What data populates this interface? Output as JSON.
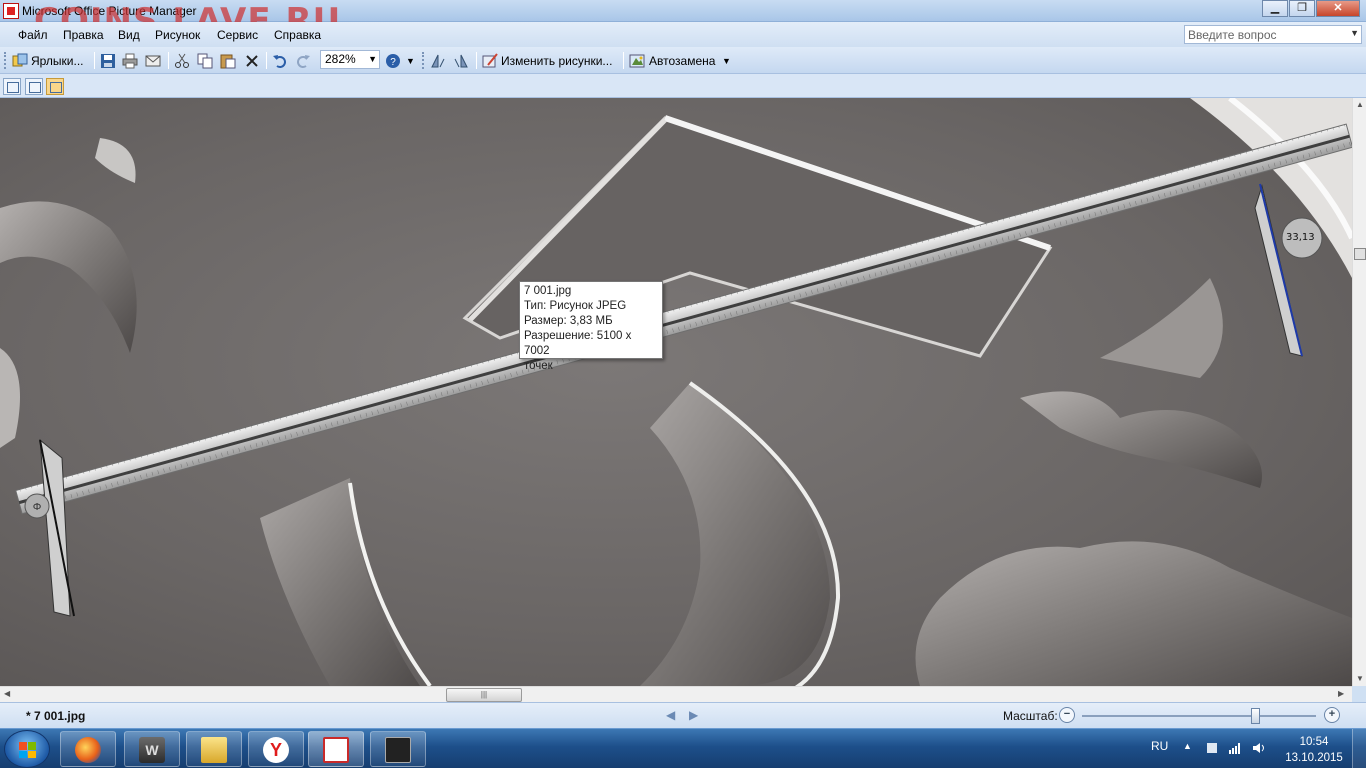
{
  "window": {
    "title": "Microsoft Office Picture Manager",
    "watermark": "COINS.LAVE.RU",
    "buttons": {
      "minimize": "▁",
      "maximize": "❐",
      "close": "✕"
    }
  },
  "menu": {
    "items": [
      {
        "label": "Файл"
      },
      {
        "label": "Правка"
      },
      {
        "label": "Вид"
      },
      {
        "label": "Рисунок"
      },
      {
        "label": "Сервис"
      },
      {
        "label": "Справка"
      }
    ],
    "help_placeholder": "Введите вопрос"
  },
  "toolbar": {
    "shortcuts_label": "Ярлыки...",
    "zoom_value": "282%",
    "edit_pictures_label": "Изменить рисунки...",
    "autocorrect_label": "Автозамена",
    "icons": [
      "shortcuts-icon",
      "save-icon",
      "print-icon",
      "email-icon",
      "cut-icon",
      "copy-icon",
      "paste-icon",
      "delete-icon",
      "undo-icon",
      "redo-icon",
      "help-icon",
      "rotate-left-icon",
      "rotate-right-icon",
      "edit-pictures-icon",
      "autocorrect-icon"
    ]
  },
  "views": {
    "buttons": [
      "thumbnail-view",
      "filmstrip-view",
      "single-picture-view"
    ],
    "active": "single-picture-view"
  },
  "caliper": {
    "reading": "33,13"
  },
  "tooltip": {
    "filename": "7 001.jpg",
    "type": "Тип: Рисунок JPEG",
    "size": "Размер: 3,83 МБ",
    "resolution": "Разрешение: 5100 x 7002",
    "unit": "точек"
  },
  "status": {
    "filename": "* 7 001.jpg",
    "zoom_label": "Масштаб:",
    "zoom_fraction": 0.74
  },
  "taskbar": {
    "apps": [
      "firefox",
      "world-of-tanks",
      "windows-explorer",
      "yandex-browser",
      "picture-manager",
      "game-cat"
    ],
    "language": "RU",
    "time": "10:54",
    "date": "13.10.2015"
  },
  "colors": {
    "title_gradient": "#a9c6e8",
    "taskbar": "#1d4f8a",
    "watermark": "#cd3232",
    "coin_surface": "#6b6766"
  }
}
